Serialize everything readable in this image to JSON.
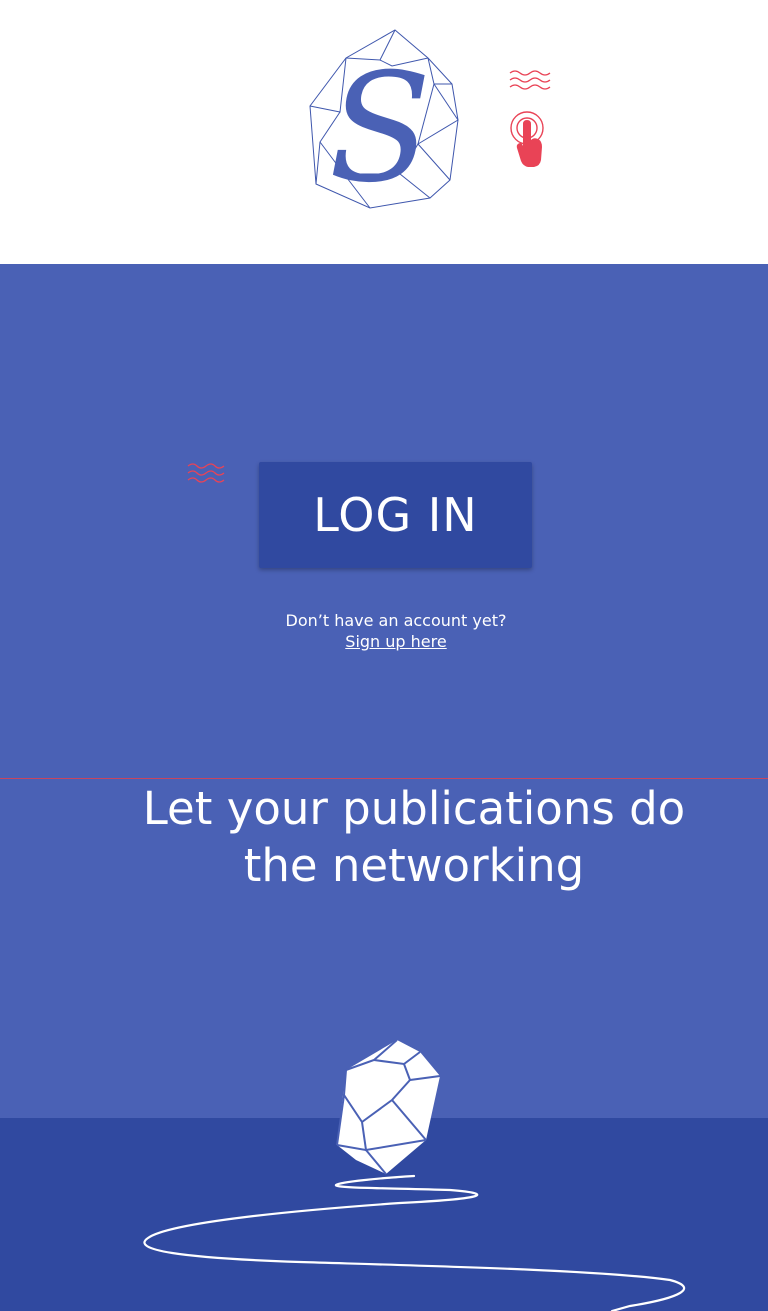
{
  "header": {
    "logo": {
      "letter": "S",
      "icon": "crystal-s-logo-icon"
    },
    "tap_hint": {
      "icons": [
        "waves-icon",
        "tap-finger-icon"
      ]
    }
  },
  "main": {
    "login_button": {
      "label": "LOG IN"
    },
    "signup": {
      "prompt": "Don’t have an account yet?",
      "link_label": "Sign up here"
    },
    "tagline": "Let your publications do the networking",
    "decorations": [
      "waves-icon",
      "gem-icon",
      "path-line"
    ]
  },
  "colors": {
    "primary_blue": "#4a61b5",
    "dark_blue": "#3049a0",
    "accent_red": "#e94356",
    "divider_red": "#c8455e",
    "white": "#ffffff"
  }
}
